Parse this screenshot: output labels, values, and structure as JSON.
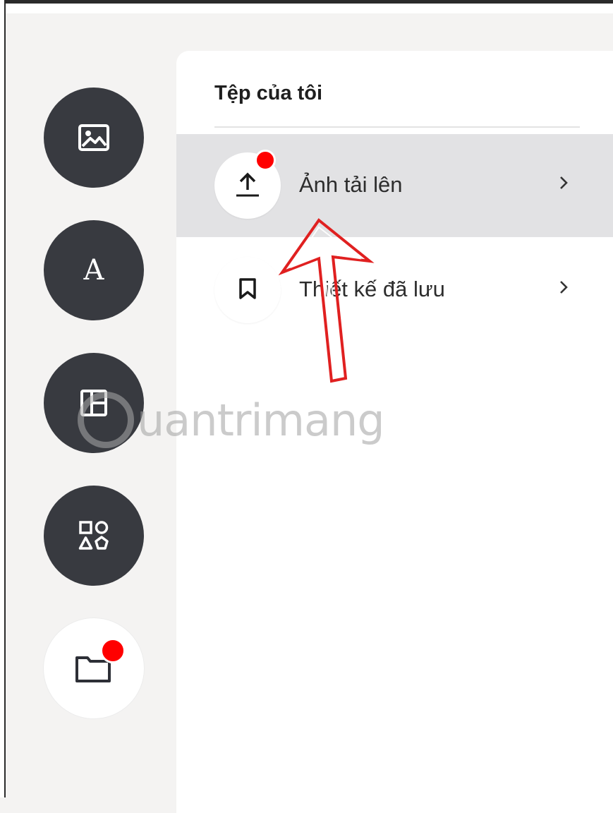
{
  "panel": {
    "title": "Tệp của tôi",
    "items": [
      {
        "label": "Ảnh tải lên",
        "icon": "upload-icon",
        "selected": true,
        "has_badge": true
      },
      {
        "label": "Thiết kế đã lưu",
        "icon": "bookmark-icon",
        "selected": false,
        "has_badge": false
      }
    ]
  },
  "rail": {
    "items": [
      {
        "icon": "image-icon"
      },
      {
        "icon": "text-icon",
        "glyph": "A"
      },
      {
        "icon": "layout-icon"
      },
      {
        "icon": "elements-icon"
      },
      {
        "icon": "folder-icon",
        "active": true,
        "has_badge": true
      }
    ]
  },
  "watermark": {
    "text": "uantrimang"
  },
  "colors": {
    "rail_dark": "#383a40",
    "badge_red": "#ff0000",
    "selected_row": "#e2e2e4",
    "annotation_red": "#e02020"
  }
}
